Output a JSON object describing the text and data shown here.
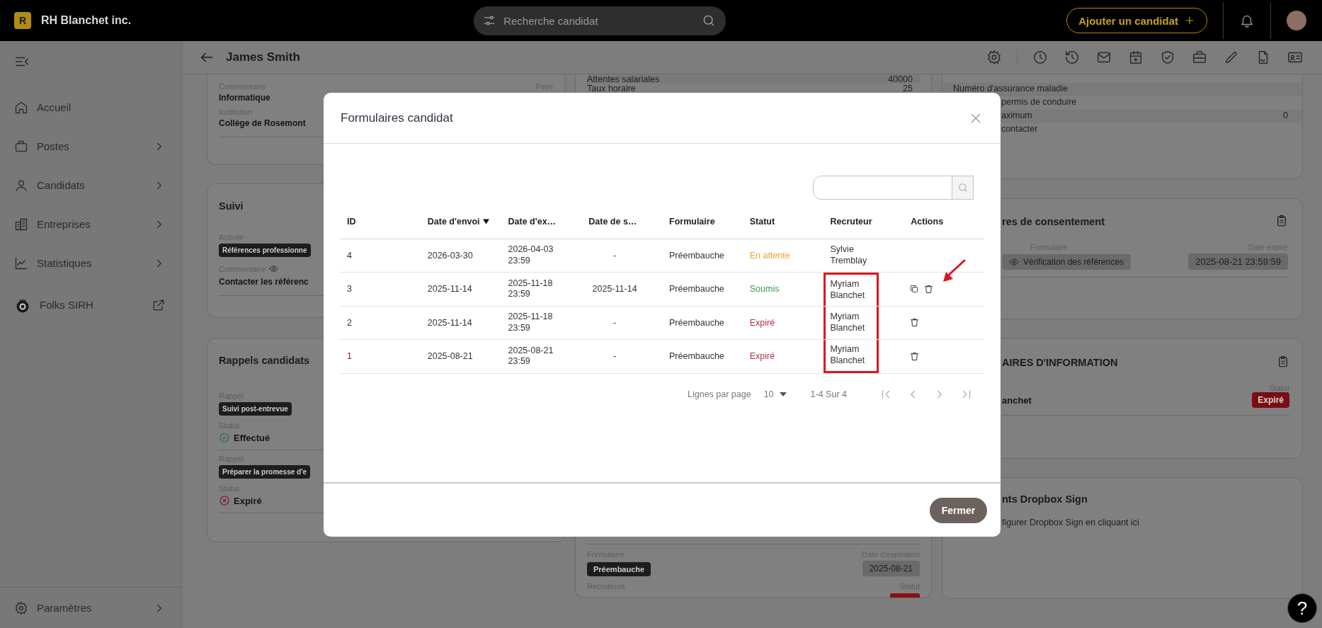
{
  "topbar": {
    "brand_initial": "R",
    "brand": "RH Blanchet inc.",
    "search": {
      "placeholder": "Recherche candidat"
    },
    "add_button": "Ajouter un candidat"
  },
  "sidebar": {
    "items": [
      {
        "label": "Accueil",
        "kind": "link"
      },
      {
        "label": "Postes",
        "kind": "group"
      },
      {
        "label": "Candidats",
        "kind": "group"
      },
      {
        "label": "Entreprises",
        "kind": "group"
      },
      {
        "label": "Statistiques",
        "kind": "group"
      },
      {
        "label": "Folks SIRH",
        "kind": "external"
      }
    ],
    "settings": {
      "label": "Paramètres",
      "kind": "group"
    }
  },
  "page_header": {
    "title": "James Smith"
  },
  "education_card": {
    "fields": [
      {
        "label": "Commentaire",
        "value": "Informatique",
        "aside": "Pays"
      },
      {
        "label": "Institution",
        "value": "Collège de Rosemont"
      }
    ]
  },
  "follow_up_card": {
    "title": "Suivi",
    "activity_label": "Activité",
    "activity": "Références professionne",
    "comment_label": "Commentaire",
    "comment": "Contacter les référenc"
  },
  "reminders_card": {
    "title": "Rappels candidats",
    "items": [
      {
        "reminder_label": "Rappel",
        "reminder": "Suivi post-entrevue",
        "status_label": "Statut",
        "status": {
          "text": "Effectué",
          "kind": "done"
        }
      },
      {
        "reminder_label": "Rappel",
        "reminder": "Préparer la promesse d'e",
        "status_label": "Statut",
        "status": {
          "text": "Expiré",
          "kind": "expired"
        }
      }
    ]
  },
  "job_profile_card": {
    "rows": [
      {
        "label": "Attentes salariales",
        "value": "40000"
      },
      {
        "label": "Taux horaire",
        "value": "25"
      }
    ],
    "form_label": "Formulaire",
    "form": "Préembauche",
    "expiry_label": "Date d'expiration",
    "expiry": "2025-08-21",
    "recruiters_label": "Recruteurs",
    "status_label": "Statut",
    "status": {
      "color": "#8a0e14"
    }
  },
  "additional_info_card": {
    "rows": [
      {
        "label": "Numéro d'assurance maladie"
      },
      {
        "label": "permis de conduire"
      },
      {
        "label": "aximum",
        "value": "0"
      },
      {
        "label": "contacter"
      }
    ]
  },
  "consent_card": {
    "title": "res de consentement",
    "form_label": "Formulaire",
    "form": "Vérification des références",
    "expiry_label": "Date expiré",
    "expiry": "2025-08-21 23:59:59"
  },
  "info_forms_card": {
    "title": "AIRES D'INFORMATION",
    "name": "anchet",
    "status_label": "Statut",
    "status": {
      "text": "Expiré",
      "color": "#7a0d12"
    }
  },
  "dropbox_card": {
    "title": "nts Dropbox Sign",
    "link": "figurer Dropbox Sign en cliquant ici"
  },
  "modal": {
    "title": "Formulaires candidat",
    "columns": [
      {
        "label": "ID",
        "sorted": false
      },
      {
        "label": "Date d'envoi",
        "sorted": true
      },
      {
        "label": "Date d'ex…",
        "sorted": false
      },
      {
        "label": "Date de s…",
        "sorted": false
      },
      {
        "label": "Formulaire",
        "sorted": false
      },
      {
        "label": "Statut",
        "sorted": false
      },
      {
        "label": "Recruteur",
        "sorted": false
      },
      {
        "label": "Actions",
        "sorted": false
      }
    ],
    "rows": [
      {
        "id": "4",
        "sent": "2026-03-30",
        "expires": "2026-04-03 23:59",
        "submitted": "-",
        "form": "Préembauche",
        "status": {
          "text": "En attente",
          "color": "#f0a030"
        },
        "recruiter": "Sylvie Tremblay",
        "actions": [],
        "hovered": false,
        "highlighted": false
      },
      {
        "id": "3",
        "sent": "2025-11-14",
        "expires": "2025-11-18 23:59",
        "submitted": "2025-11-14",
        "form": "Préembauche",
        "status": {
          "text": "Soumis",
          "color": "#3a9a4a"
        },
        "recruiter": "Myriam Blanchet",
        "actions": [
          {
            "kind": "copy"
          },
          {
            "kind": "delete"
          }
        ],
        "hovered": false,
        "highlighted": true
      },
      {
        "id": "2",
        "sent": "2025-11-14",
        "expires": "2025-11-18 23:59",
        "submitted": "-",
        "form": "Préembauche",
        "status": {
          "text": "Expiré",
          "color": "#b03048"
        },
        "recruiter": "Myriam Blanchet",
        "actions": [
          {
            "kind": "delete"
          }
        ],
        "hovered": false,
        "highlighted": true
      },
      {
        "id": "1",
        "sent": "2025-08-21",
        "expires": "2025-08-21 23:59",
        "submitted": "-",
        "form": "Préembauche",
        "status": {
          "text": "Expiré",
          "color": "#b03048"
        },
        "recruiter": "Myriam Blanchet",
        "actions": [
          {
            "kind": "delete"
          }
        ],
        "hovered": true,
        "highlighted": true
      }
    ],
    "pagination": {
      "rows_per_page_label": "Lignes par page",
      "rows_per_page": "10",
      "range": "1-4 Sur 4"
    },
    "close_button": "Fermer"
  },
  "help_button": "?"
}
